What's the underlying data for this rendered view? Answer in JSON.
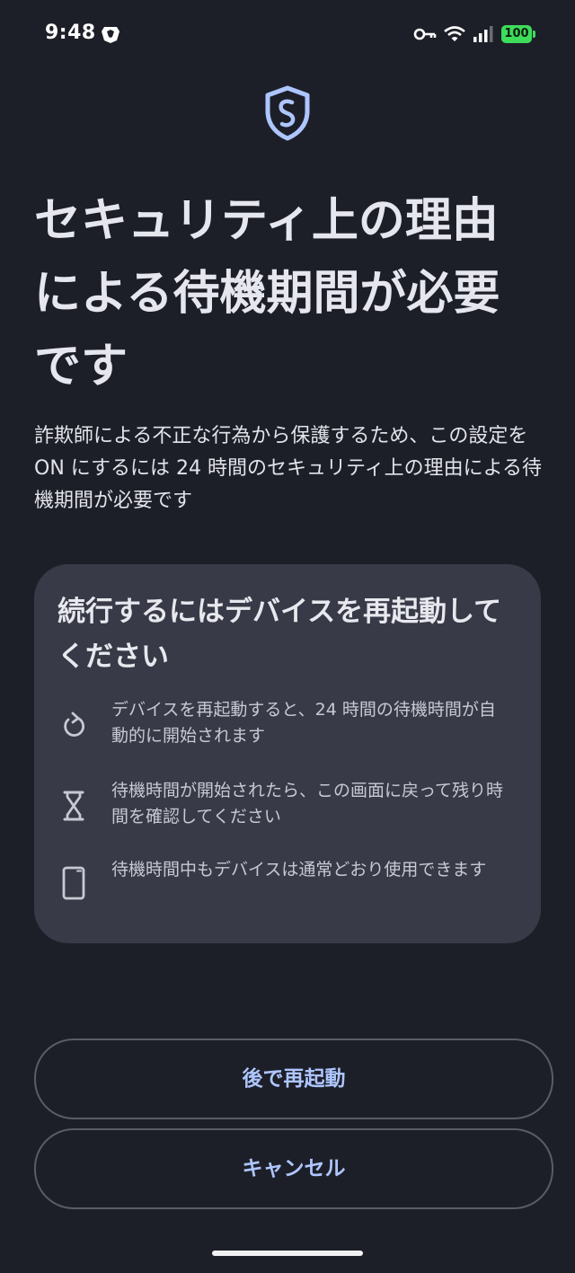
{
  "status_bar": {
    "time": "9:48",
    "battery": "100",
    "icons": [
      "brave-icon",
      "key-icon",
      "wifi-icon",
      "signal-icon",
      "battery-icon"
    ]
  },
  "header": {
    "icon": "shield-icon",
    "title": "セキュリティ上の理由による待機期間が必要です"
  },
  "description": "詐欺師による不正な行為から保護するため、この設定を ON にするには 24 時間のセキュリティ上の理由による待機期間が必要です",
  "card": {
    "title": "続行するにはデバイスを再起動してください",
    "items": [
      {
        "icon": "restart-icon",
        "text": "デバイスを再起動すると、24 時間の待機時間が自動的に開始されます"
      },
      {
        "icon": "hourglass-icon",
        "text": "待機時間が開始されたら、この画面に戻って残り時間を確認してください"
      },
      {
        "icon": "phone-icon",
        "text": "待機時間中もデバイスは通常どおり使用できます"
      }
    ]
  },
  "buttons": {
    "restart_later": "後で再起動",
    "cancel": "キャンセル"
  },
  "colors": {
    "background": "#1d1f28",
    "card": "#383a47",
    "accent": "#aec6ff",
    "battery": "#3ddc5a"
  }
}
